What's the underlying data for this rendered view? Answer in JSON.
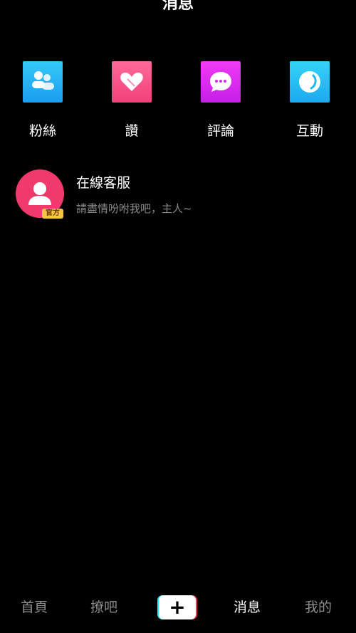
{
  "header": {
    "title": "消息"
  },
  "categories": [
    {
      "label": "粉絲",
      "icon": "fans-icon",
      "color": "#1fa8f2"
    },
    {
      "label": "讚",
      "icon": "like-heart-icon",
      "color": "#f04a80"
    },
    {
      "label": "評論",
      "icon": "comment-bubble-icon",
      "color": "#d22ef0"
    },
    {
      "label": "互動",
      "icon": "interaction-icon",
      "color": "#22b6f2"
    }
  ],
  "conversations": [
    {
      "name": "在線客服",
      "badge": "官方",
      "preview": "請盡情吩咐我吧，主人~",
      "avatar_color": "#f03a6c"
    }
  ],
  "bottom_nav": {
    "items": [
      "首頁",
      "撩吧",
      "消息",
      "我的"
    ],
    "plus": "+",
    "active": "消息"
  }
}
